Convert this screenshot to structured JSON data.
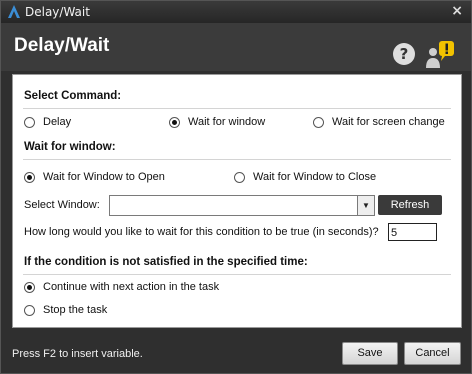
{
  "window": {
    "title": "Delay/Wait",
    "close_glyph": "×"
  },
  "header": {
    "title": "Delay/Wait",
    "help_glyph": "?"
  },
  "select_command": {
    "title": "Select Command:",
    "options": [
      {
        "label": "Delay",
        "selected": false
      },
      {
        "label": "Wait for window",
        "selected": true
      },
      {
        "label": "Wait for screen change",
        "selected": false
      }
    ]
  },
  "wait_for_window": {
    "title": "Wait for window:",
    "options": [
      {
        "label": "Wait for Window to Open",
        "selected": true
      },
      {
        "label": "Wait for Window to Close",
        "selected": false
      }
    ],
    "select_label": "Select Window:",
    "select_value": "",
    "refresh_label": "Refresh",
    "timeout_question": "How long would you like to wait for this condition to be true (in seconds)?",
    "timeout_value": "5"
  },
  "not_satisfied": {
    "title": "If the condition is not satisfied in the specified time:",
    "options": [
      {
        "label": "Continue with next action in the task",
        "selected": true
      },
      {
        "label": "Stop the task",
        "selected": false
      }
    ]
  },
  "footer": {
    "hint": "Press F2 to insert variable.",
    "save_label": "Save",
    "cancel_label": "Cancel"
  },
  "colors": {
    "accent": "#3b8ed6",
    "header_bg": "#3b3b3b",
    "chrome_bg": "#2f2f2f",
    "badge": "#f2c200"
  },
  "icons": {
    "app": "automation-anywhere-logo-icon",
    "help": "help-icon",
    "user": "user-alert-icon"
  }
}
